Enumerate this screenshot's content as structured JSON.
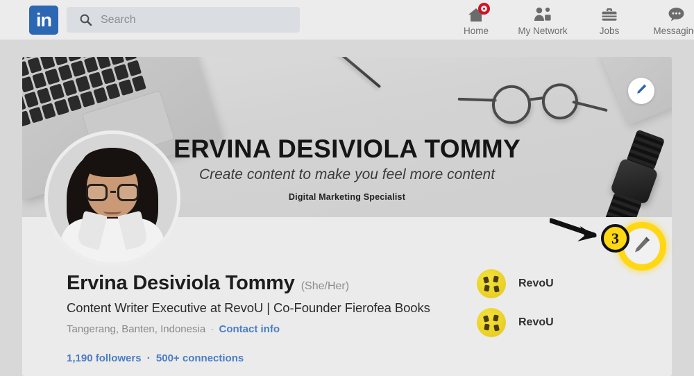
{
  "nav": {
    "logo_text": "in",
    "search_placeholder": "Search",
    "search_value": "",
    "items": [
      {
        "label": "Home",
        "icon": "home-icon",
        "badge": true
      },
      {
        "label": "My Network",
        "icon": "network-icon",
        "badge": false
      },
      {
        "label": "Jobs",
        "icon": "jobs-briefcase-icon",
        "badge": false
      },
      {
        "label": "Messaging",
        "icon": "messaging-bubble-icon",
        "badge": false
      }
    ]
  },
  "banner": {
    "name": "ERVINA DESIVIOLA TOMMY",
    "tagline": "Create content to make you feel more content",
    "subtitle": "Digital Marketing Specialist",
    "edit_icon": "pencil-edit-icon"
  },
  "profile": {
    "name": "Ervina Desiviola Tommy",
    "pronouns": "(She/Her)",
    "headline": "Content Writer Executive at RevoU | Co-Founder Fierofea Books",
    "location": "Tangerang, Banten, Indonesia",
    "separator": "·",
    "contact_info": "Contact info",
    "followers": "1,190 followers",
    "stats_separator": "·",
    "connections": "500+ connections"
  },
  "companies": [
    {
      "name": "RevoU",
      "logo": "revou-logo-icon"
    },
    {
      "name": "RevoU",
      "logo": "revou-logo-icon"
    }
  ],
  "annotation": {
    "step_number": "3",
    "arrow_icon": "arrow-right-icon",
    "highlight_target": "edit-profile-pencil-icon"
  },
  "colors": {
    "linkedin_blue": "#2c67b3",
    "link_blue": "#4a7dc4",
    "annotation_yellow": "#ffd713",
    "notification_red": "#d11124",
    "revou_yellow": "#e9cf24",
    "page_bg": "#d8d8d8",
    "card_bg": "#ebebeb",
    "nav_bg": "#ececed"
  }
}
